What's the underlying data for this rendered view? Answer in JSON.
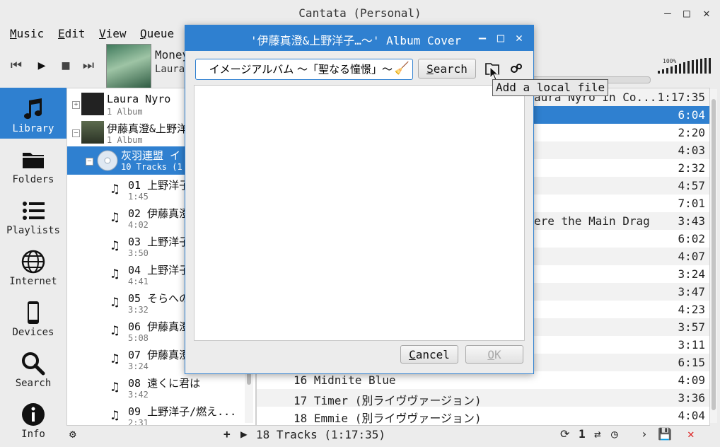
{
  "window": {
    "title": "Cantata (Personal)"
  },
  "menu": [
    "Music",
    "Edit",
    "View",
    "Queue"
  ],
  "now_playing": {
    "title": "Money",
    "artist": "Laura"
  },
  "volume": {
    "label": "100%",
    "level": 1.0
  },
  "sidebar": {
    "items": [
      {
        "label": "Library",
        "icon": "music-note-icon",
        "active": true
      },
      {
        "label": "Folders",
        "icon": "folder-icon"
      },
      {
        "label": "Playlists",
        "icon": "list-icon"
      },
      {
        "label": "Internet",
        "icon": "globe-icon"
      },
      {
        "label": "Devices",
        "icon": "phone-icon"
      },
      {
        "label": "Search",
        "icon": "magnifier-icon"
      },
      {
        "label": "Info",
        "icon": "info-icon"
      }
    ]
  },
  "library": {
    "artists": [
      {
        "name": "Laura Nyro",
        "sub": "1 Album"
      },
      {
        "name": "伊藤真澄&上野洋",
        "sub": "1 Album"
      }
    ],
    "album": {
      "name": "灰羽連盟 イ",
      "sub": "10 Tracks (1"
    },
    "tracks": [
      {
        "title": "01 上野洋子",
        "duration": "1:45"
      },
      {
        "title": "02 伊藤真澄",
        "duration": "4:02"
      },
      {
        "title": "03 上野洋子",
        "duration": "3:50"
      },
      {
        "title": "04 上野洋子",
        "duration": "4:41"
      },
      {
        "title": "05 そらへの",
        "duration": "3:32"
      },
      {
        "title": "06 伊藤真澄",
        "duration": "5:08"
      },
      {
        "title": "07 伊藤真澄",
        "duration": "3:24"
      },
      {
        "title": "08 遠くに君は",
        "duration": "3:42"
      },
      {
        "title": "09 上野洋子/燃え...",
        "duration": "2:31"
      }
    ]
  },
  "playlist": {
    "rows": [
      {
        "title": "aura Nyro In Co...",
        "time": "1:17:35"
      },
      {
        "title": "",
        "time": "6:04"
      },
      {
        "title": "",
        "time": "2:20"
      },
      {
        "title": "",
        "time": "4:03"
      },
      {
        "title": "",
        "time": "2:32"
      },
      {
        "title": "",
        "time": "4:57"
      },
      {
        "title": "",
        "time": "7:01"
      },
      {
        "title": "ere the Main Drag",
        "time": "3:43"
      },
      {
        "title": "",
        "time": "6:02"
      },
      {
        "title": "",
        "time": "4:07"
      },
      {
        "title": "",
        "time": "3:24"
      },
      {
        "title": "",
        "time": "3:47"
      },
      {
        "title": "",
        "time": "4:23"
      },
      {
        "title": "",
        "time": "3:57"
      },
      {
        "title": "",
        "time": "3:11"
      },
      {
        "title": "",
        "time": "6:15"
      },
      {
        "title": "16 Midnite Blue",
        "time": "4:09"
      },
      {
        "title": "17 Timer (別ライヴヴァージョン)",
        "time": "3:36"
      },
      {
        "title": "18 Emmie (別ライヴヴァージョン)",
        "time": "4:04"
      }
    ]
  },
  "status": {
    "text": "18 Tracks (1:17:35)",
    "single": "1"
  },
  "dialog": {
    "title": "'伊藤真澄&上野洋子…～' Album Cover",
    "search_value": "イメージアルバム ～「聖なる憧憬」～",
    "search_label": "Search",
    "cancel_label": "Cancel",
    "ok_label": "OK",
    "tooltip": "Add a local file"
  },
  "colors": {
    "accent": "#2f80d0"
  }
}
